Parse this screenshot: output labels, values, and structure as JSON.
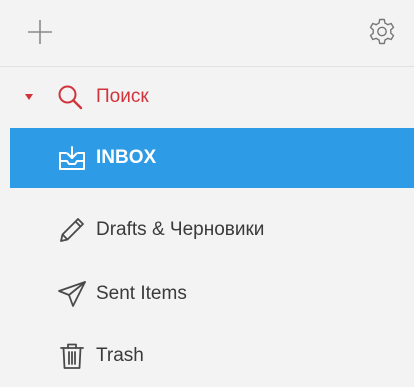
{
  "toolbar": {
    "add_icon": "plus-icon",
    "settings_icon": "gear-icon"
  },
  "search": {
    "label": "Поиск",
    "expanded": true,
    "caret_icon": "caret-down-icon",
    "icon": "search-icon",
    "color": "#d0343a"
  },
  "folders": [
    {
      "id": "inbox",
      "label": "INBOX",
      "icon": "inbox-tray-icon",
      "selected": true
    },
    {
      "id": "drafts",
      "label": "Drafts & Черновики",
      "icon": "pencil-icon",
      "selected": false
    },
    {
      "id": "sent",
      "label": "Sent Items",
      "icon": "paper-plane-icon",
      "selected": false
    },
    {
      "id": "trash",
      "label": "Trash",
      "icon": "trash-icon",
      "selected": false
    }
  ],
  "colors": {
    "selected_bg": "#2e9be6",
    "background": "#f3f3f3",
    "text": "#3a3a3a"
  }
}
